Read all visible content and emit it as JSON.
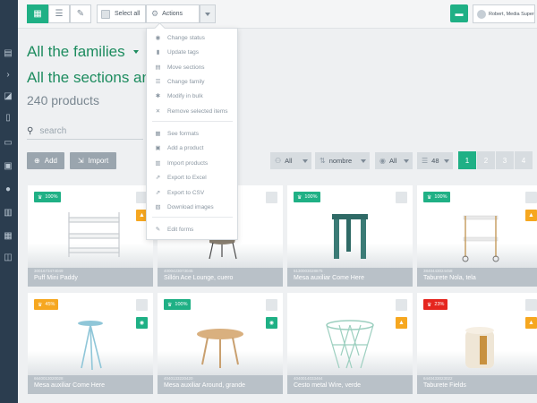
{
  "toolbar": {
    "select_all": "Select all",
    "actions": "Actions",
    "user": "Robert, Media Super"
  },
  "header": {
    "families": "All the families",
    "sections": "All the sections and",
    "count": "240 products"
  },
  "search": {
    "placeholder": "search"
  },
  "buttons": {
    "add": "Add",
    "import": "Import"
  },
  "filters": {
    "status": "All",
    "sort": "nombre",
    "visibility": "All",
    "per_page": "48"
  },
  "pagination": [
    "1",
    "2",
    "3",
    "4"
  ],
  "actions_menu": [
    {
      "icon": "eye-icon",
      "glyph": "◉",
      "label": "Change status"
    },
    {
      "icon": "bookmark-icon",
      "glyph": "▮",
      "label": "Update tags"
    },
    {
      "icon": "section-icon",
      "glyph": "▤",
      "label": "Move sections"
    },
    {
      "icon": "list-icon",
      "glyph": "☰",
      "label": "Change family"
    },
    {
      "icon": "asterisk-icon",
      "glyph": "✱",
      "label": "Modify in bulk"
    },
    {
      "icon": "close-icon",
      "glyph": "✕",
      "label": "Remove selected items"
    },
    {
      "icon": "formats-icon",
      "glyph": "▦",
      "label": "See formats"
    },
    {
      "icon": "add-product-icon",
      "glyph": "▣",
      "label": "Add a product"
    },
    {
      "icon": "import-icon",
      "glyph": "▥",
      "label": "Import products"
    },
    {
      "icon": "export-excel-icon",
      "glyph": "⇗",
      "label": "Export to Excel"
    },
    {
      "icon": "export-csv-icon",
      "glyph": "⇗",
      "label": "Export to CSV"
    },
    {
      "icon": "download-images-icon",
      "glyph": "▧",
      "label": "Download images"
    },
    {
      "icon": "edit-forms-icon",
      "glyph": "✎",
      "label": "Edit forms"
    }
  ],
  "products": [
    {
      "badge": "100%",
      "badge_color": "#1fb085",
      "sku": "3001673474049",
      "name": "Puff Mini Paddy",
      "flag": "warn"
    },
    {
      "badge": "",
      "badge_color": "",
      "sku": "4000423073045",
      "name": "Sillón Ace Lounge, cuero",
      "flag": "none"
    },
    {
      "badge": "100%",
      "badge_color": "#1fb085",
      "sku": "5130003028875",
      "name": "Mesa auxiliar Come Here",
      "flag": "none"
    },
    {
      "badge": "100%",
      "badge_color": "#1fb085",
      "sku": "3840443024458",
      "name": "Taburete Nola, tela",
      "flag": "warn"
    },
    {
      "badge": "45%",
      "badge_color": "#f6a720",
      "sku": "6640013020028",
      "name": "Mesa auxiliar Come Here",
      "flag": "eye"
    },
    {
      "badge": "100%",
      "badge_color": "#1fb085",
      "sku": "4040133220420",
      "name": "Mesa auxiliar Around, grande",
      "flag": "eye"
    },
    {
      "badge": "",
      "badge_color": "",
      "sku": "4040014033464",
      "name": "Cesto metal Wire, verde",
      "flag": "warn"
    },
    {
      "badge": "23%",
      "badge_color": "#e5261f",
      "sku": "6440433023022",
      "name": "Taburete Fields",
      "flag": "warn"
    }
  ],
  "colors": {
    "accent": "#1fb085",
    "sidebar": "#2b3d4f",
    "warning": "#f6a720",
    "danger": "#e5261f"
  }
}
